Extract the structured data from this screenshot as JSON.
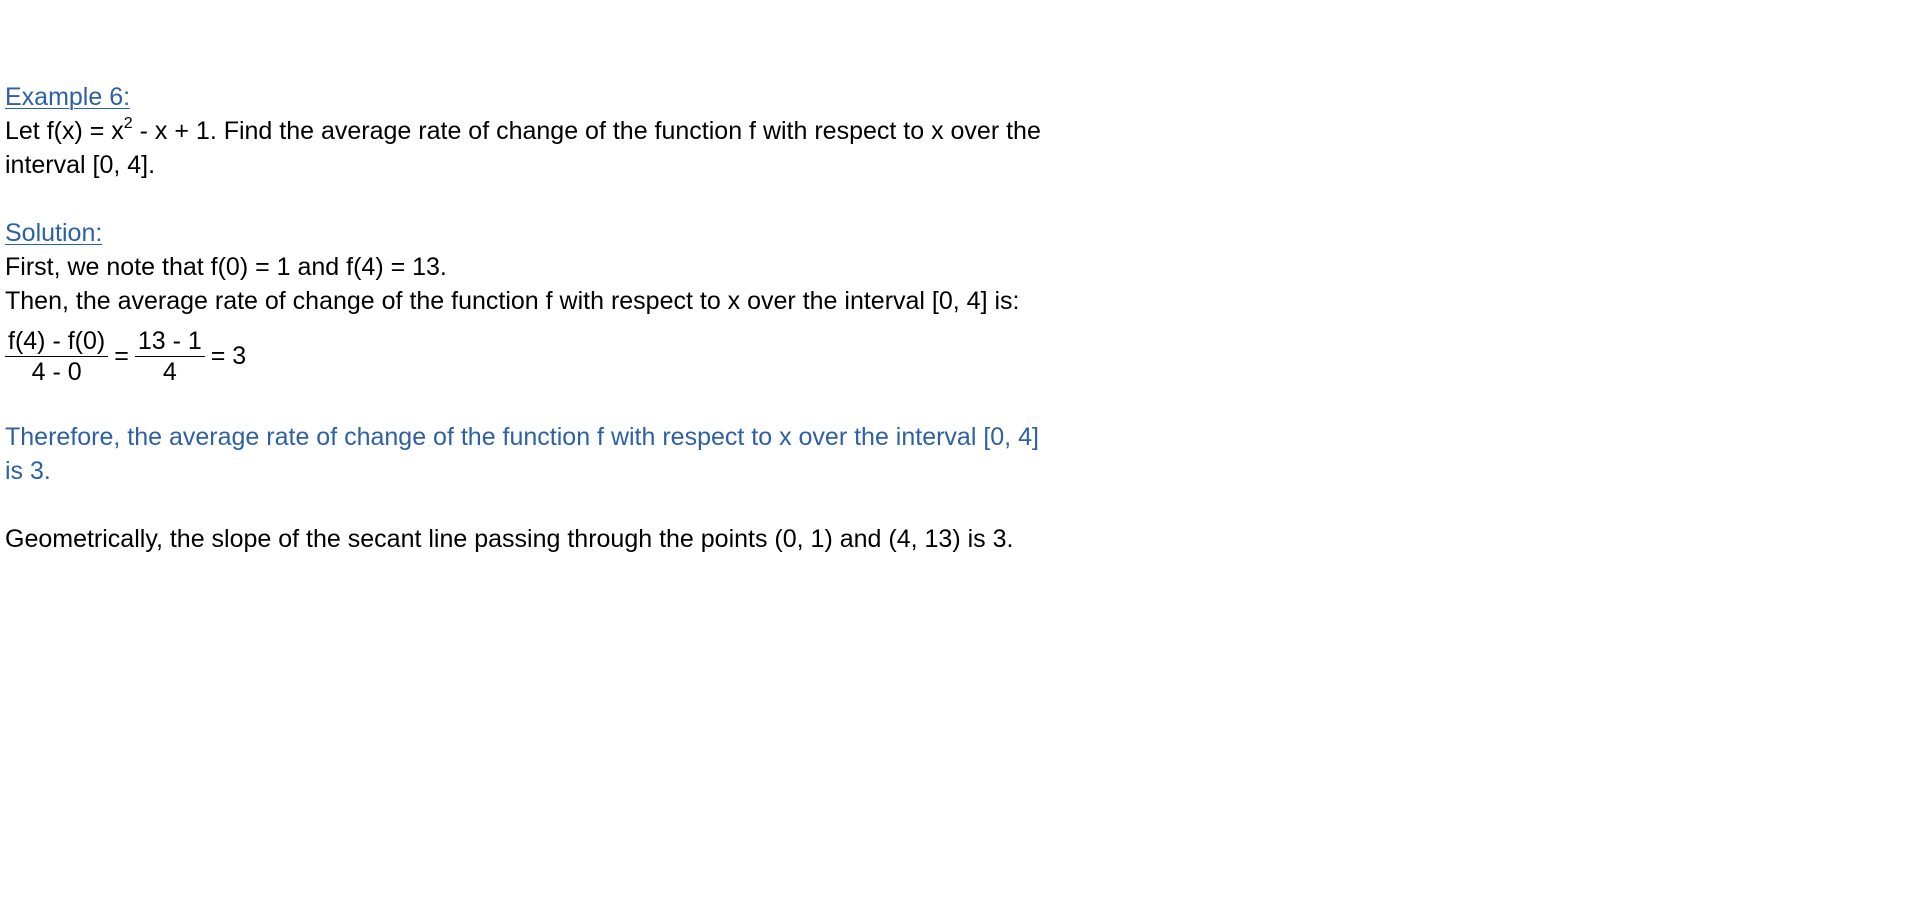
{
  "example": {
    "heading": "Example 6:",
    "problem_part1": "Let f(x) = x",
    "problem_exponent": "2",
    "problem_part2": " - x + 1.  Find the average rate of change of the function f with respect to x over the interval [0, 4]."
  },
  "solution": {
    "heading": "Solution:",
    "line1": "First, we note that f(0) = 1 and  f(4) = 13.",
    "line2": "Then, the average rate of change of the function f with respect to x over the interval [0, 4] is:",
    "equation": {
      "frac1_num": "f(4) - f(0)",
      "frac1_den": "4 - 0",
      "equals1": "=",
      "frac2_num": "13 - 1",
      "frac2_den": "4",
      "result": "= 3"
    },
    "conclusion": "Therefore, the average rate of change of the function f with respect to x over the interval [0, 4] is 3.",
    "geometric_note": "Geometrically, the slope of the secant line passing through the points (0, 1) and (4, 13) is 3."
  },
  "colors": {
    "accent": "#2e60a6",
    "text": "#000000",
    "background": "#ffffff"
  }
}
